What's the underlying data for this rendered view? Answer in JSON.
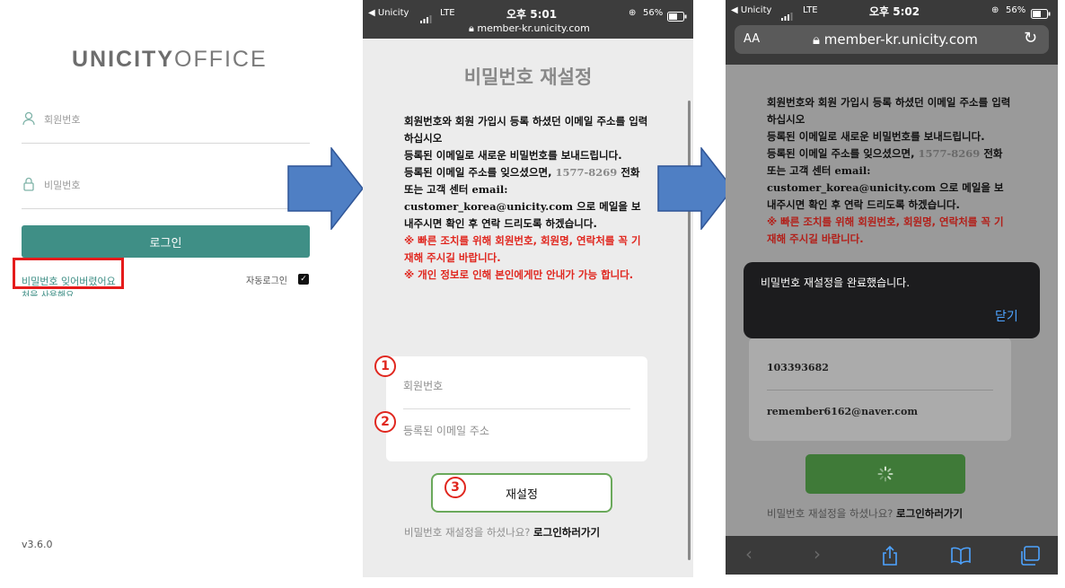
{
  "login": {
    "logo_bold": "UNICITY",
    "logo_light": "OFFICE",
    "member_placeholder": "회원번호",
    "password_placeholder": "비밀번호",
    "login_button": "로그인",
    "forgot_password": "비밀번호 잊어버렸어요",
    "first_time": "처음 사용해요",
    "auto_login": "자동로그인",
    "version": "v3.6.0"
  },
  "reset": {
    "status": {
      "carrier": "◀ Unicity",
      "network": "LTE",
      "time": "오후 5:01",
      "battery": "56%",
      "url": "member-kr.unicity.com"
    },
    "title": "비밀번호 재설정",
    "line1": "회원번호와 회원 가입시 등록 하셨던 이메일 주소를 입력 하십시오",
    "line2": "등록된 이메일로 새로운 비밀번호를 보내드립니다.",
    "line3a": "등록된 이메일 주소를 잊으셨으면,",
    "phone": "1577-8269",
    "line3b": "전화 또는 고객 센터",
    "email_label": "email:",
    "email": "customer_korea@unicity.com",
    "line3c": "으로 메일을 보내주시면 확인 후 연락 드리도록 하겠습니다.",
    "warn1": "※ 빠른 조치를 위해 회원번호, 회원명, 연락처를 꼭 기재해 주시길 바랍니다.",
    "warn2": "※ 개인 정보로 인해 본인에게만 안내가 가능 합니다.",
    "member_placeholder": "회원번호",
    "email_placeholder": "등록된 이메일 주소",
    "submit": "재설정",
    "bottom_text": "비밀번호 재설정을 하셨나요?",
    "bottom_link": "로그인하러가기",
    "step1": "1",
    "step2": "2",
    "step3": "3"
  },
  "done": {
    "status": {
      "carrier": "◀ Unicity",
      "network": "LTE",
      "time": "오후 5:02",
      "battery": "56%",
      "url": "member-kr.unicity.com",
      "text_size": "AA"
    },
    "member_value": "103393682",
    "email_value": "remember6162@naver.com",
    "toast_message": "비밀번호 재설정을 완료했습니다.",
    "toast_close": "닫기",
    "bottom_text": "비밀번호 재설정을 하셨나요?",
    "bottom_link": "로그인하러가기"
  },
  "colors": {
    "brand": "#3f8f86",
    "highlight": "#e51b1b",
    "arrow": "#4f7fc4",
    "warning": "#e0271f",
    "submit_border": "#6aa95b"
  }
}
